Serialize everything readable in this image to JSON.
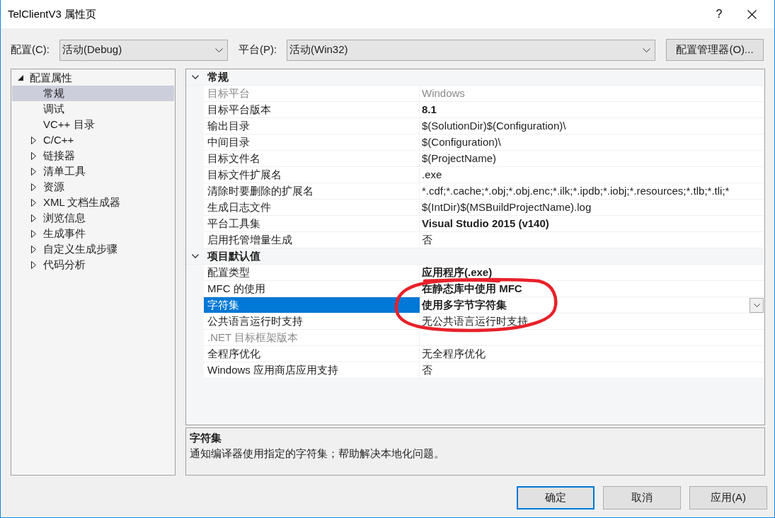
{
  "window": {
    "title": "TelClientV3 属性页",
    "help_button": "?"
  },
  "toolbar": {
    "configuration": {
      "label": "配置(C):",
      "value": "活动(Debug)"
    },
    "platform": {
      "label": "平台(P):",
      "value": "活动(Win32)"
    },
    "manager_button": "配置管理器(O)..."
  },
  "tree": [
    {
      "kind": "group",
      "label": "配置属性",
      "expanded": true,
      "selected": false,
      "children": [
        {
          "kind": "leaf",
          "label": "常规",
          "selected": true
        },
        {
          "kind": "leaf",
          "label": "调试",
          "selected": false
        },
        {
          "kind": "leaf",
          "label": "VC++ 目录",
          "selected": false
        },
        {
          "kind": "group",
          "label": "C/C++",
          "expanded": false,
          "selected": false
        },
        {
          "kind": "group",
          "label": "链接器",
          "expanded": false,
          "selected": false
        },
        {
          "kind": "group",
          "label": "清单工具",
          "expanded": false,
          "selected": false
        },
        {
          "kind": "group",
          "label": "资源",
          "expanded": false,
          "selected": false
        },
        {
          "kind": "group",
          "label": "XML 文档生成器",
          "expanded": false,
          "selected": false
        },
        {
          "kind": "group",
          "label": "浏览信息",
          "expanded": false,
          "selected": false
        },
        {
          "kind": "group",
          "label": "生成事件",
          "expanded": false,
          "selected": false
        },
        {
          "kind": "group",
          "label": "自定义生成步骤",
          "expanded": false,
          "selected": false
        },
        {
          "kind": "group",
          "label": "代码分析",
          "expanded": false,
          "selected": false
        }
      ]
    }
  ],
  "grid": {
    "categories": [
      {
        "label": "常规",
        "expanded": true,
        "rows": [
          {
            "name": "目标平台",
            "value": "Windows",
            "disabled": true,
            "modified": false,
            "selected": false
          },
          {
            "name": "目标平台版本",
            "value": "8.1",
            "disabled": false,
            "modified": true,
            "selected": false
          },
          {
            "name": "输出目录",
            "value": "$(SolutionDir)$(Configuration)\\",
            "disabled": false,
            "modified": false,
            "selected": false
          },
          {
            "name": "中间目录",
            "value": "$(Configuration)\\",
            "disabled": false,
            "modified": false,
            "selected": false
          },
          {
            "name": "目标文件名",
            "value": "$(ProjectName)",
            "disabled": false,
            "modified": false,
            "selected": false
          },
          {
            "name": "目标文件扩展名",
            "value": ".exe",
            "disabled": false,
            "modified": false,
            "selected": false
          },
          {
            "name": "清除时要删除的扩展名",
            "value": "*.cdf;*.cache;*.obj;*.obj.enc;*.ilk;*.ipdb;*.iobj;*.resources;*.tlb;*.tli;*",
            "disabled": false,
            "modified": false,
            "selected": false
          },
          {
            "name": "生成日志文件",
            "value": "$(IntDir)$(MSBuildProjectName).log",
            "disabled": false,
            "modified": false,
            "selected": false
          },
          {
            "name": "平台工具集",
            "value": "Visual Studio 2015 (v140)",
            "disabled": false,
            "modified": true,
            "selected": false
          },
          {
            "name": "启用托管增量生成",
            "value": "否",
            "disabled": false,
            "modified": false,
            "selected": false
          }
        ]
      },
      {
        "label": "项目默认值",
        "expanded": true,
        "rows": [
          {
            "name": "配置类型",
            "value": "应用程序(.exe)",
            "disabled": false,
            "modified": true,
            "selected": false
          },
          {
            "name": "MFC 的使用",
            "value": "在静态库中使用 MFC",
            "disabled": false,
            "modified": true,
            "selected": false
          },
          {
            "name": "字符集",
            "value": "使用多字节字符集",
            "disabled": false,
            "modified": true,
            "selected": true
          },
          {
            "name": "公共语言运行时支持",
            "value": "无公共语言运行时支持",
            "disabled": false,
            "modified": false,
            "selected": false
          },
          {
            "name": ".NET 目标框架版本",
            "disabled": true,
            "selected": false
          },
          {
            "name": "全程序优化",
            "value": "无全程序优化",
            "disabled": false,
            "modified": false,
            "selected": false
          },
          {
            "name": "Windows 应用商店应用支持",
            "value": "否",
            "disabled": false,
            "modified": false,
            "selected": false
          }
        ]
      }
    ]
  },
  "description": {
    "title": "字符集",
    "text": "通知编译器使用指定的字符集；帮助解决本地化问题。"
  },
  "buttons": [
    {
      "label": "确定",
      "default": true
    },
    {
      "label": "取消",
      "default": false
    },
    {
      "label": "应用(A)",
      "default": false
    }
  ],
  "annotations": [
    {
      "kind": "ellipse"
    }
  ]
}
